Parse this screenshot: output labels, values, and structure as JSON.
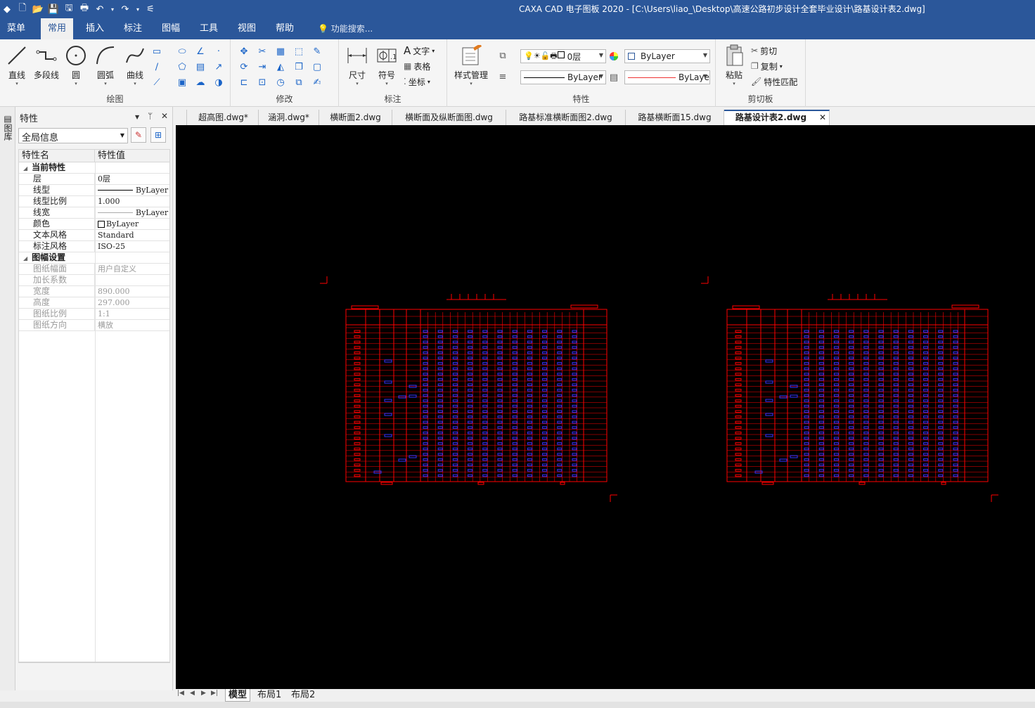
{
  "window": {
    "title": "CAXA CAD 电子图板 2020 - [C:\\Users\\liao_\\Desktop\\高速公路初步设计全套毕业设计\\路基设计表2.dwg]"
  },
  "quick_access": [
    {
      "name": "app-icon",
      "glyph": "◆"
    },
    {
      "name": "new-file-icon",
      "glyph": "🗋"
    },
    {
      "name": "open-folder-icon",
      "glyph": "📂"
    },
    {
      "name": "save-icon",
      "glyph": "💾"
    },
    {
      "name": "save-all-icon",
      "glyph": "🖫"
    },
    {
      "name": "print-icon",
      "glyph": "🖶"
    },
    {
      "name": "undo-icon",
      "glyph": "↶"
    },
    {
      "name": "undo-dropdown-icon",
      "glyph": "▾"
    },
    {
      "name": "redo-icon",
      "glyph": "↷"
    },
    {
      "name": "redo-dropdown-icon",
      "glyph": "▾"
    },
    {
      "name": "customize-qat-icon",
      "glyph": "⚟"
    }
  ],
  "menu": {
    "tabs": [
      "菜单",
      "常用",
      "插入",
      "标注",
      "图幅",
      "工具",
      "视图",
      "帮助"
    ],
    "active": "常用",
    "search_placeholder": "功能搜索..."
  },
  "ribbon": {
    "draw": {
      "label": "绘图",
      "buttons": [
        "直线",
        "多段线",
        "圆",
        "圆弧",
        "曲线"
      ]
    },
    "modify": {
      "label": "修改"
    },
    "annotate": {
      "label": "标注",
      "buttons": [
        "尺寸",
        "符号"
      ],
      "small": [
        "文字",
        "表格",
        "坐标"
      ]
    },
    "properties": {
      "label": "特性",
      "style_button": "样式管理",
      "layer": "0层",
      "color": "ByLayer",
      "linetype": "ByLayer",
      "lineweight": "ByLaye"
    },
    "clipboard": {
      "label": "剪切板",
      "paste": "粘贴",
      "small": [
        "剪切",
        "复制",
        "特性匹配"
      ]
    }
  },
  "panel": {
    "title": "特性",
    "side_label": "图库",
    "scope": "全局信息",
    "headers": [
      "特性名",
      "特性值"
    ],
    "categories": [
      {
        "name": "当前特性",
        "rows": [
          {
            "k": "层",
            "v": "0层",
            "type": "text"
          },
          {
            "k": "线型",
            "v": "ByLayer",
            "type": "line"
          },
          {
            "k": "线型比例",
            "v": "1.000",
            "type": "text"
          },
          {
            "k": "线宽",
            "v": "ByLayer",
            "type": "thin"
          },
          {
            "k": "颜色",
            "v": "ByLayer",
            "type": "color"
          },
          {
            "k": "文本风格",
            "v": "Standard",
            "type": "text"
          },
          {
            "k": "标注风格",
            "v": "ISO-25",
            "type": "text"
          }
        ]
      },
      {
        "name": "图幅设置",
        "rows": [
          {
            "k": "图纸幅面",
            "v": "用户自定义",
            "type": "dim"
          },
          {
            "k": "加长系数",
            "v": "",
            "type": "dim"
          },
          {
            "k": "宽度",
            "v": "890.000",
            "type": "dim"
          },
          {
            "k": "高度",
            "v": "297.000",
            "type": "dim"
          },
          {
            "k": "图纸比例",
            "v": "1:1",
            "type": "dim"
          },
          {
            "k": "图纸方向",
            "v": "横放",
            "type": "dim"
          }
        ]
      }
    ]
  },
  "document_tabs": [
    "超高图.dwg*",
    "涵洞.dwg*",
    "横断面2.dwg",
    "横断面及纵断面图.dwg",
    "路基标准横断面图2.dwg",
    "路基横断面15.dwg",
    "路基设计表2.dwg"
  ],
  "active_document": "路基设计表2.dwg",
  "layout_tabs": [
    "模型",
    "布局1",
    "布局2"
  ],
  "active_layout": "模型",
  "colors": {
    "canvas": "#000000",
    "drawing_lines": "#ff0000",
    "drawing_text": "#3333ff",
    "accent": "#2b579a"
  }
}
